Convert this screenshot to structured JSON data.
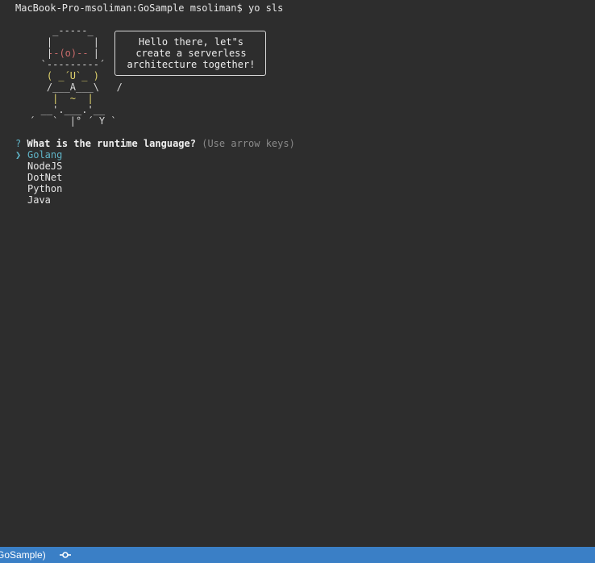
{
  "terminal": {
    "prompt_line": "MacBook-Pro-msoliman:GoSample msoliman$ yo sls",
    "speech_bubble": "Hello there, let\"s\ncreate a serverless\narchitecture together!",
    "question": {
      "mark": "?",
      "text": "What is the runtime language?",
      "hint": "(Use arrow keys)"
    },
    "cursor_glyph": "❯",
    "options": [
      "Golang",
      "NodeJS",
      "DotNet",
      "Python",
      "Java"
    ],
    "selected_option": "Golang"
  },
  "statusbar": {
    "text": "GoSample)",
    "icon": "git-commit-icon"
  },
  "colors": {
    "background": "#2d2d2d",
    "accent": "#5fb3c6",
    "statusbar": "#3a7fc6"
  }
}
